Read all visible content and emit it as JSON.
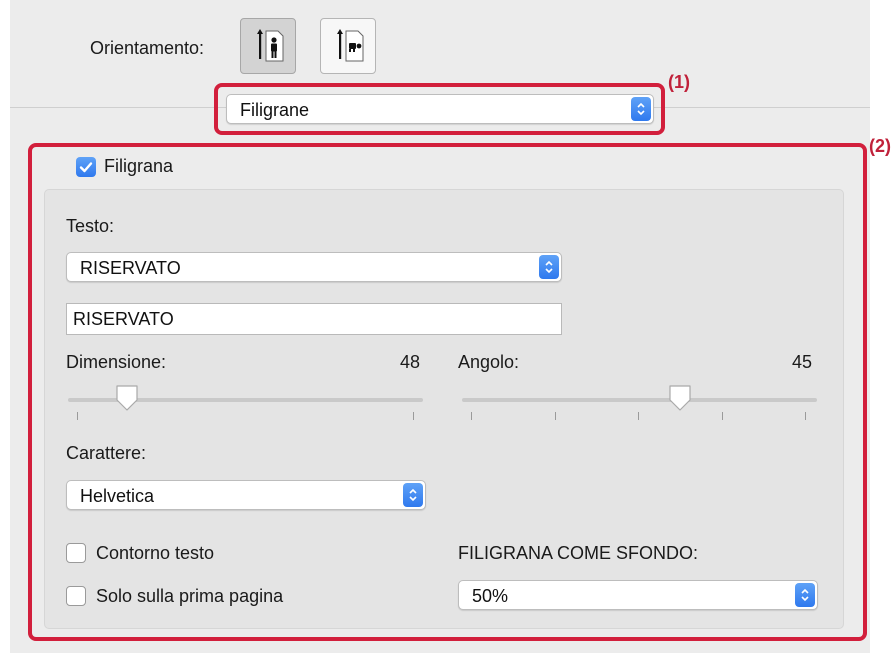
{
  "orientation": {
    "label": "Orientamento:",
    "buttons": [
      {
        "name": "orientation-portrait-button",
        "icon": "portrait-orientation-icon",
        "selected": true
      },
      {
        "name": "orientation-landscape-button",
        "icon": "landscape-orientation-icon",
        "selected": false
      }
    ]
  },
  "section_popup": {
    "value": "Filigrane"
  },
  "callouts": {
    "c1": "(1)",
    "c2": "(2)"
  },
  "watermark": {
    "enabled": true,
    "checkbox_label": "Filigrana",
    "text_label": "Testo:",
    "text_popup_value": "RISERVATO",
    "text_field_value": "RISERVATO",
    "size": {
      "label": "Dimensione:",
      "value": "48"
    },
    "angle": {
      "label": "Angolo:",
      "value": "45"
    },
    "font_label": "Carattere:",
    "font_value": "Helvetica",
    "outline": {
      "label": "Contorno testo",
      "checked": false
    },
    "first_page": {
      "label": "Solo sulla prima pagina",
      "checked": false
    },
    "background": {
      "label": "FILIGRANA COME SFONDO:",
      "value": "50%"
    }
  },
  "colors": {
    "highlight": "#d21f3c",
    "accent": "#2f79ee"
  }
}
